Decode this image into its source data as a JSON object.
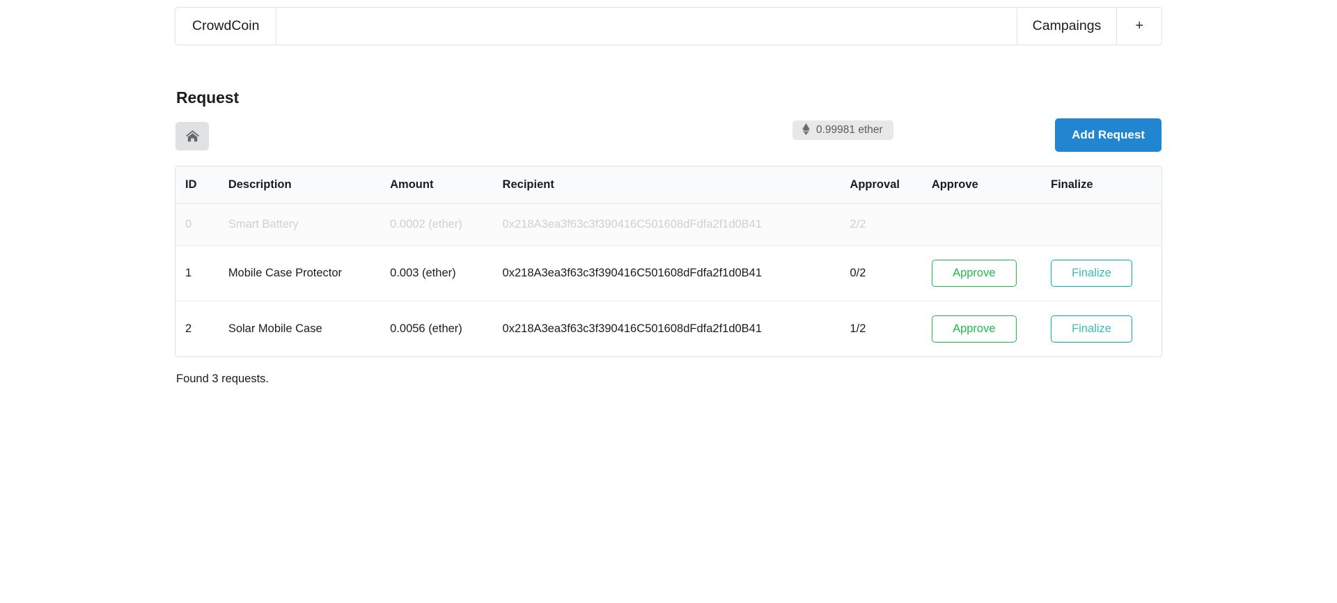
{
  "navbar": {
    "brand": "CrowdCoin",
    "items": [
      {
        "label": "Campaings",
        "name": "nav-item-campaigns"
      },
      {
        "label": "+",
        "name": "nav-item-add"
      }
    ]
  },
  "header": {
    "title": "Request"
  },
  "toolbar": {
    "home_icon": "home-icon",
    "balance": {
      "icon": "ethereum-icon",
      "glyph": "♦",
      "value": "0.99981 ether"
    },
    "add_request_label": "Add Request",
    "add_request_color": "#2185d0"
  },
  "table": {
    "columns": [
      "ID",
      "Description",
      "Amount",
      "Recipient",
      "Approval",
      "Approve",
      "Finalize"
    ],
    "rows": [
      {
        "id": "0",
        "description": "Smart Battery",
        "amount": "0.0002 (ether)",
        "recipient": "0x218A3ea3f63c3f390416C501608dFdfa2f1d0B41",
        "approval": "2/2",
        "complete": true,
        "approve_label": "",
        "finalize_label": ""
      },
      {
        "id": "1",
        "description": "Mobile Case Protector",
        "amount": "0.003 (ether)",
        "recipient": "0x218A3ea3f63c3f390416C501608dFdfa2f1d0B41",
        "approval": "0/2",
        "complete": false,
        "approve_label": "Approve",
        "finalize_label": "Finalize"
      },
      {
        "id": "2",
        "description": "Solar Mobile Case",
        "amount": "0.0056 (ether)",
        "recipient": "0x218A3ea3f63c3f390416C501608dFdfa2f1d0B41",
        "approval": "1/2",
        "complete": false,
        "approve_label": "Approve",
        "finalize_label": "Finalize"
      }
    ],
    "approve_color": "#21ba45",
    "finalize_color": "#00b5ad"
  },
  "footer": {
    "found_text": "Found 3 requests."
  }
}
